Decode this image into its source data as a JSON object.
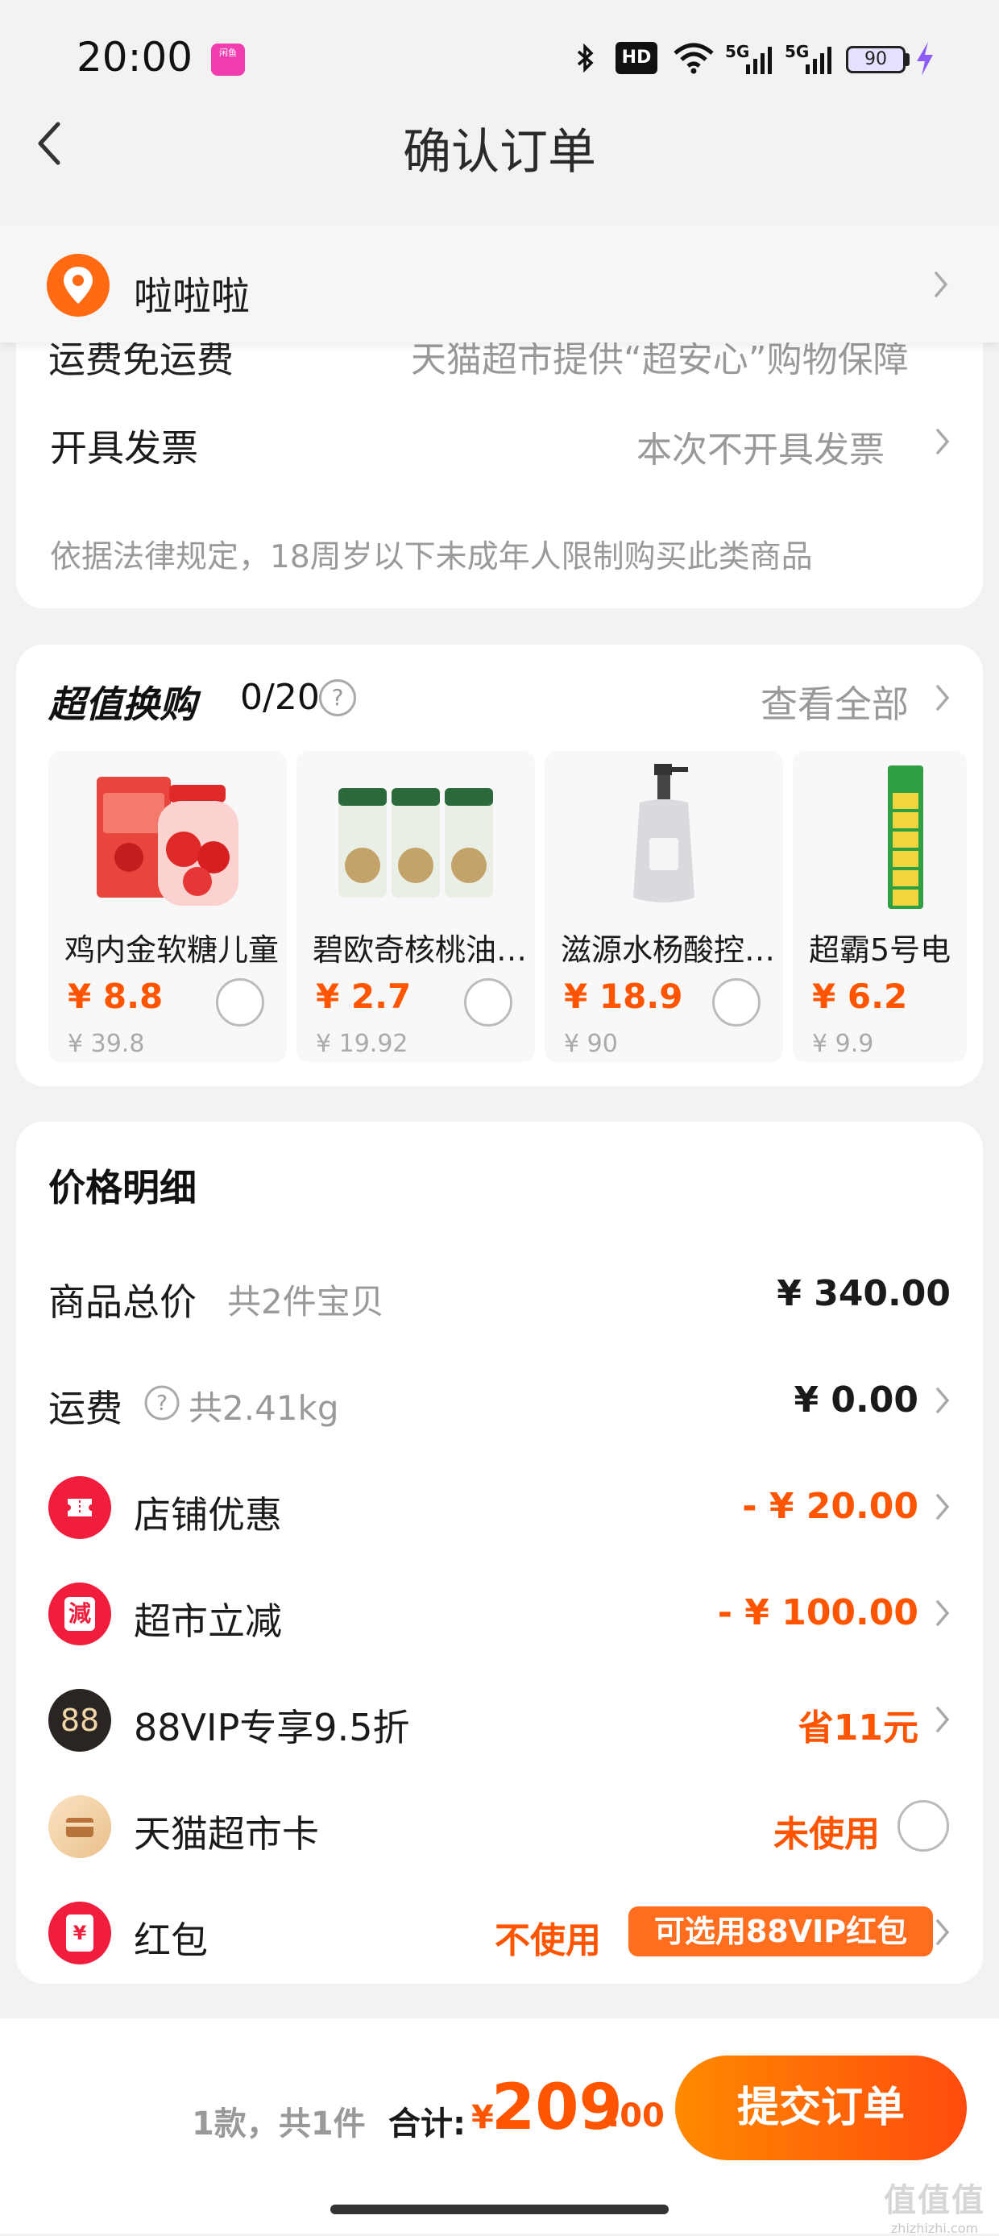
{
  "status_bar": {
    "time": "20:00",
    "app_badge": "闲鱼",
    "hd_label": "HD",
    "signal_1": "5G",
    "signal_2": "5G",
    "battery_level": "90"
  },
  "header": {
    "title": "确认订单"
  },
  "address": {
    "name": "啦啦啦"
  },
  "order_info": {
    "clipped_left": "运费免运费",
    "clipped_right": "天猫超市提供“超安心”购物保障",
    "invoice_label": "开具发票",
    "invoice_value": "本次不开具发票",
    "legal_note": "依据法律规定，18周岁以下未成年人限制购买此类商品"
  },
  "exchange": {
    "title": "超值换购",
    "count": "0/20",
    "help_glyph": "?",
    "see_all": "查看全部",
    "items": [
      {
        "name": "鸡内金软糖儿童",
        "price": "¥ 8.8",
        "original": "¥ 39.8",
        "selected": false
      },
      {
        "name": "碧欧奇核桃油婴幼儿",
        "price": "¥ 2.7",
        "original": "¥ 19.92",
        "selected": false
      },
      {
        "name": "滋源水杨酸控油洗发水",
        "price": "¥ 18.9",
        "original": "¥ 90",
        "selected": false
      },
      {
        "name": "超霸5号电",
        "price": "¥ 6.2",
        "original": "¥ 9.9",
        "selected": false
      }
    ]
  },
  "price_detail": {
    "title": "价格明细",
    "goods_total_label": "商品总价",
    "goods_total_sub": "共2件宝贝",
    "goods_total_value": "¥ 340.00",
    "shipping_label": "运费",
    "shipping_sub": "共2.41kg",
    "shipping_value": "¥ 0.00",
    "shop_discount_label": "店铺优惠",
    "shop_discount_value": "- ¥ 20.00",
    "market_cut_label": "超市立减",
    "market_cut_icon_text": "減",
    "market_cut_value": "- ¥ 100.00",
    "vip_label": "88VIP专享9.5折",
    "vip_icon_text": "88",
    "vip_value": "省11元",
    "card_label": "天猫超市卡",
    "card_value": "未使用",
    "redpack_label": "红包",
    "redpack_icon_text": "¥",
    "redpack_value": "不使用",
    "redpack_tag": "可选用88VIP红包"
  },
  "bottom": {
    "count_text": "1款，共1件",
    "total_label": "合计:",
    "currency": "¥",
    "total_int": "209",
    "total_dec": ".00",
    "submit": "提交订单"
  },
  "watermark": {
    "big": "值值值",
    "small": "zhizhizhi.com"
  },
  "colors": {
    "accent": "#ff5500",
    "button_start": "#ff8a00",
    "button_end": "#ff4b0e",
    "red_icon": "#f01e3c",
    "page_bg": "#f2f2f2"
  },
  "icons": [
    "back-icon",
    "location-pin-icon",
    "chevron-right-icon",
    "help-circle-icon",
    "ticket-icon",
    "minus-badge-icon",
    "vip88-icon",
    "card-icon",
    "redpack-icon"
  ]
}
